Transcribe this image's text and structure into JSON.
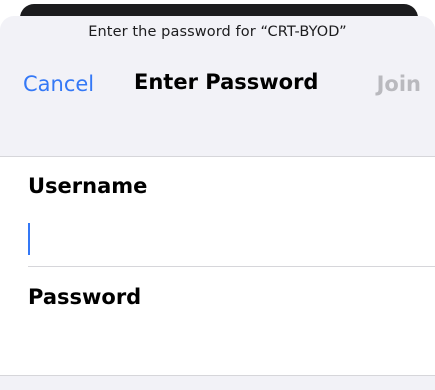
{
  "dialog": {
    "prompt": "Enter the password for “CRT-BYOD”",
    "title": "Enter Password",
    "cancel_label": "Cancel",
    "join_label": "Join"
  },
  "form": {
    "username": {
      "label": "Username",
      "value": ""
    },
    "password": {
      "label": "Password",
      "value": ""
    }
  },
  "colors": {
    "accent": "#3478f6",
    "disabled": "#b9b9be",
    "sheet_background": "#f2f2f7"
  }
}
